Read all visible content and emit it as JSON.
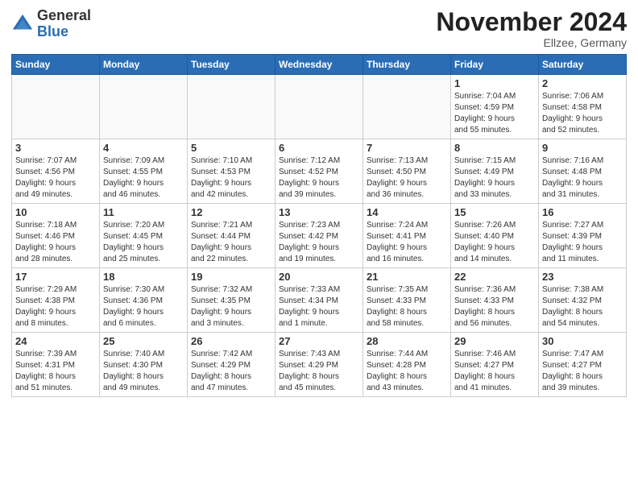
{
  "header": {
    "logo_general": "General",
    "logo_blue": "Blue",
    "month_title": "November 2024",
    "location": "Ellzee, Germany"
  },
  "weekdays": [
    "Sunday",
    "Monday",
    "Tuesday",
    "Wednesday",
    "Thursday",
    "Friday",
    "Saturday"
  ],
  "weeks": [
    [
      {
        "day": "",
        "info": ""
      },
      {
        "day": "",
        "info": ""
      },
      {
        "day": "",
        "info": ""
      },
      {
        "day": "",
        "info": ""
      },
      {
        "day": "",
        "info": ""
      },
      {
        "day": "1",
        "info": "Sunrise: 7:04 AM\nSunset: 4:59 PM\nDaylight: 9 hours\nand 55 minutes."
      },
      {
        "day": "2",
        "info": "Sunrise: 7:06 AM\nSunset: 4:58 PM\nDaylight: 9 hours\nand 52 minutes."
      }
    ],
    [
      {
        "day": "3",
        "info": "Sunrise: 7:07 AM\nSunset: 4:56 PM\nDaylight: 9 hours\nand 49 minutes."
      },
      {
        "day": "4",
        "info": "Sunrise: 7:09 AM\nSunset: 4:55 PM\nDaylight: 9 hours\nand 46 minutes."
      },
      {
        "day": "5",
        "info": "Sunrise: 7:10 AM\nSunset: 4:53 PM\nDaylight: 9 hours\nand 42 minutes."
      },
      {
        "day": "6",
        "info": "Sunrise: 7:12 AM\nSunset: 4:52 PM\nDaylight: 9 hours\nand 39 minutes."
      },
      {
        "day": "7",
        "info": "Sunrise: 7:13 AM\nSunset: 4:50 PM\nDaylight: 9 hours\nand 36 minutes."
      },
      {
        "day": "8",
        "info": "Sunrise: 7:15 AM\nSunset: 4:49 PM\nDaylight: 9 hours\nand 33 minutes."
      },
      {
        "day": "9",
        "info": "Sunrise: 7:16 AM\nSunset: 4:48 PM\nDaylight: 9 hours\nand 31 minutes."
      }
    ],
    [
      {
        "day": "10",
        "info": "Sunrise: 7:18 AM\nSunset: 4:46 PM\nDaylight: 9 hours\nand 28 minutes."
      },
      {
        "day": "11",
        "info": "Sunrise: 7:20 AM\nSunset: 4:45 PM\nDaylight: 9 hours\nand 25 minutes."
      },
      {
        "day": "12",
        "info": "Sunrise: 7:21 AM\nSunset: 4:44 PM\nDaylight: 9 hours\nand 22 minutes."
      },
      {
        "day": "13",
        "info": "Sunrise: 7:23 AM\nSunset: 4:42 PM\nDaylight: 9 hours\nand 19 minutes."
      },
      {
        "day": "14",
        "info": "Sunrise: 7:24 AM\nSunset: 4:41 PM\nDaylight: 9 hours\nand 16 minutes."
      },
      {
        "day": "15",
        "info": "Sunrise: 7:26 AM\nSunset: 4:40 PM\nDaylight: 9 hours\nand 14 minutes."
      },
      {
        "day": "16",
        "info": "Sunrise: 7:27 AM\nSunset: 4:39 PM\nDaylight: 9 hours\nand 11 minutes."
      }
    ],
    [
      {
        "day": "17",
        "info": "Sunrise: 7:29 AM\nSunset: 4:38 PM\nDaylight: 9 hours\nand 8 minutes."
      },
      {
        "day": "18",
        "info": "Sunrise: 7:30 AM\nSunset: 4:36 PM\nDaylight: 9 hours\nand 6 minutes."
      },
      {
        "day": "19",
        "info": "Sunrise: 7:32 AM\nSunset: 4:35 PM\nDaylight: 9 hours\nand 3 minutes."
      },
      {
        "day": "20",
        "info": "Sunrise: 7:33 AM\nSunset: 4:34 PM\nDaylight: 9 hours\nand 1 minute."
      },
      {
        "day": "21",
        "info": "Sunrise: 7:35 AM\nSunset: 4:33 PM\nDaylight: 8 hours\nand 58 minutes."
      },
      {
        "day": "22",
        "info": "Sunrise: 7:36 AM\nSunset: 4:33 PM\nDaylight: 8 hours\nand 56 minutes."
      },
      {
        "day": "23",
        "info": "Sunrise: 7:38 AM\nSunset: 4:32 PM\nDaylight: 8 hours\nand 54 minutes."
      }
    ],
    [
      {
        "day": "24",
        "info": "Sunrise: 7:39 AM\nSunset: 4:31 PM\nDaylight: 8 hours\nand 51 minutes."
      },
      {
        "day": "25",
        "info": "Sunrise: 7:40 AM\nSunset: 4:30 PM\nDaylight: 8 hours\nand 49 minutes."
      },
      {
        "day": "26",
        "info": "Sunrise: 7:42 AM\nSunset: 4:29 PM\nDaylight: 8 hours\nand 47 minutes."
      },
      {
        "day": "27",
        "info": "Sunrise: 7:43 AM\nSunset: 4:29 PM\nDaylight: 8 hours\nand 45 minutes."
      },
      {
        "day": "28",
        "info": "Sunrise: 7:44 AM\nSunset: 4:28 PM\nDaylight: 8 hours\nand 43 minutes."
      },
      {
        "day": "29",
        "info": "Sunrise: 7:46 AM\nSunset: 4:27 PM\nDaylight: 8 hours\nand 41 minutes."
      },
      {
        "day": "30",
        "info": "Sunrise: 7:47 AM\nSunset: 4:27 PM\nDaylight: 8 hours\nand 39 minutes."
      }
    ]
  ]
}
